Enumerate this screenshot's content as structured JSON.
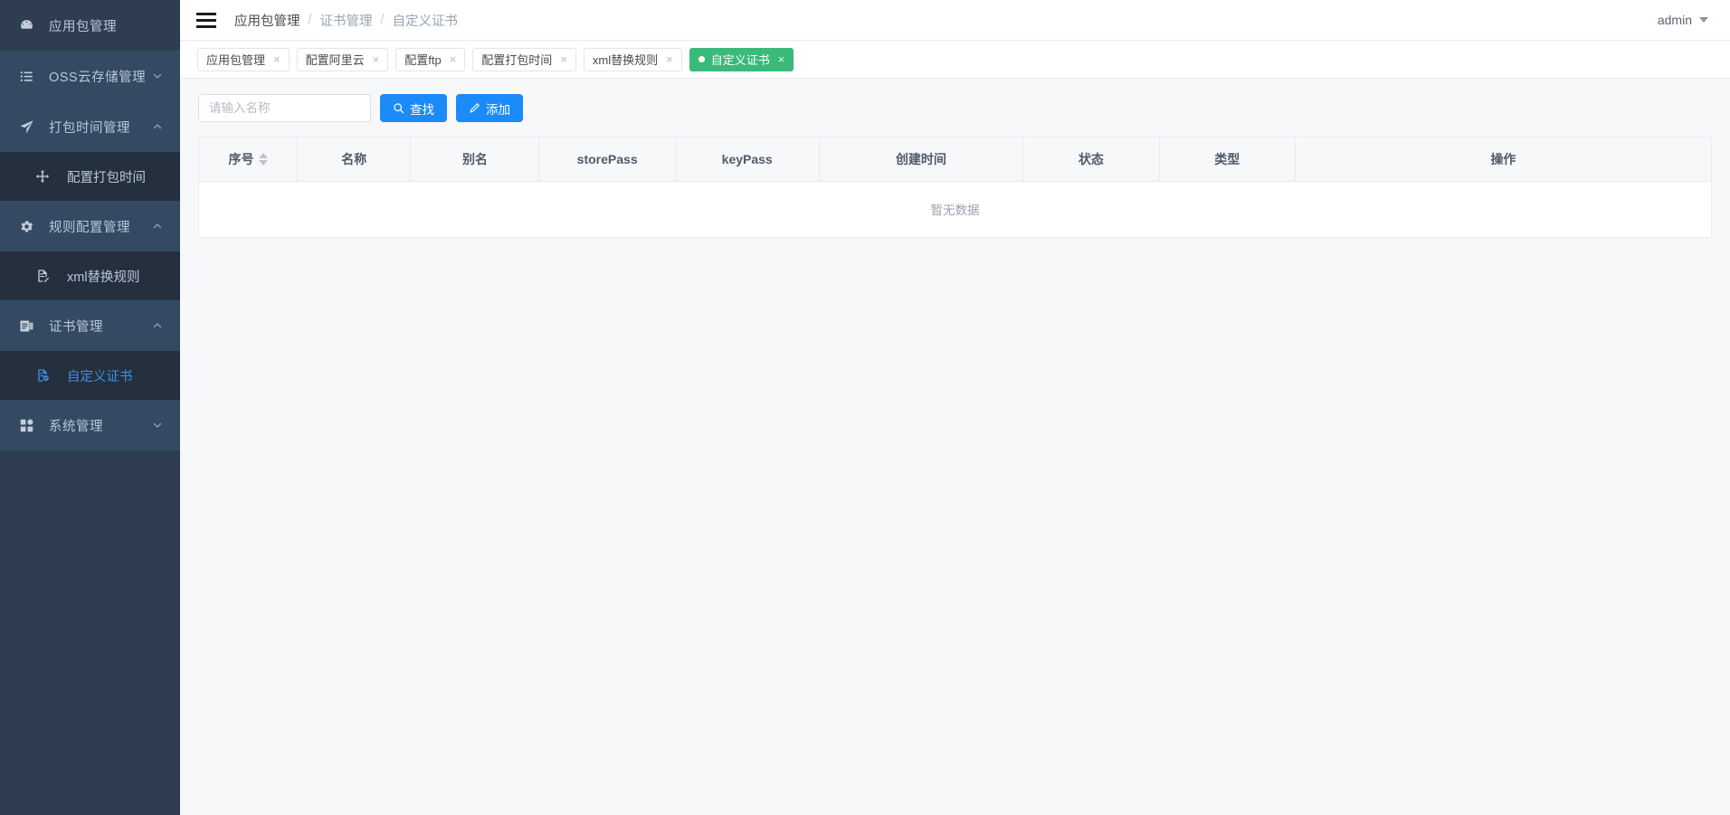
{
  "sidebar": {
    "items": [
      {
        "label": "应用包管理",
        "icon": "dashboard-icon",
        "level": 1,
        "expandable": false,
        "expanded": false,
        "active": false,
        "shade": "plain"
      },
      {
        "label": "OSS云存储管理",
        "icon": "list-icon",
        "level": 1,
        "expandable": true,
        "expanded": false,
        "active": false,
        "shade": "raised"
      },
      {
        "label": "打包时间管理",
        "icon": "paper-plane-icon",
        "level": 1,
        "expandable": true,
        "expanded": true,
        "active": false,
        "shade": "raised"
      },
      {
        "label": "配置打包时间",
        "icon": "move-arrows-icon",
        "level": 2,
        "expandable": false,
        "expanded": false,
        "active": false,
        "shade": "sub"
      },
      {
        "label": "规则配置管理",
        "icon": "gear-icon",
        "level": 1,
        "expandable": true,
        "expanded": true,
        "active": false,
        "shade": "raised"
      },
      {
        "label": "xml替换规则",
        "icon": "file-edit-icon",
        "level": 2,
        "expandable": false,
        "expanded": false,
        "active": false,
        "shade": "sub"
      },
      {
        "label": "证书管理",
        "icon": "certificate-icon",
        "level": 1,
        "expandable": true,
        "expanded": true,
        "active": false,
        "shade": "raised"
      },
      {
        "label": "自定义证书",
        "icon": "file-check-icon",
        "level": 2,
        "expandable": false,
        "expanded": false,
        "active": true,
        "shade": "sub"
      },
      {
        "label": "系统管理",
        "icon": "grid-icon",
        "level": 1,
        "expandable": true,
        "expanded": false,
        "active": false,
        "shade": "raised"
      }
    ]
  },
  "topbar": {
    "menu_toggle_icon": "hamburger-icon",
    "breadcrumb": [
      "应用包管理",
      "证书管理",
      "自定义证书"
    ],
    "breadcrumb_separator": "/",
    "user": "admin",
    "user_caret_icon": "chevron-down-icon"
  },
  "tabs": [
    {
      "label": "应用包管理",
      "active": false,
      "closable": true
    },
    {
      "label": "配置阿里云",
      "active": false,
      "closable": true
    },
    {
      "label": "配置ftp",
      "active": false,
      "closable": true
    },
    {
      "label": "配置打包时间",
      "active": false,
      "closable": true
    },
    {
      "label": "xml替换规则",
      "active": false,
      "closable": true
    },
    {
      "label": "自定义证书",
      "active": true,
      "closable": true
    }
  ],
  "tab_close_glyph": "×",
  "toolbar": {
    "search_placeholder": "请输入名称",
    "search_value": "",
    "search_button_label": "查找",
    "search_button_icon": "search-icon",
    "add_button_label": "添加",
    "add_button_icon": "pencil-icon"
  },
  "table": {
    "columns": [
      {
        "label": "序号",
        "sortable": true,
        "width": "6.5%"
      },
      {
        "label": "名称",
        "sortable": false,
        "width": "7.5%"
      },
      {
        "label": "别名",
        "sortable": false,
        "width": "8.5%"
      },
      {
        "label": "storePass",
        "sortable": false,
        "width": "9%"
      },
      {
        "label": "keyPass",
        "sortable": false,
        "width": "9.5%"
      },
      {
        "label": "创建时间",
        "sortable": false,
        "width": "13.5%"
      },
      {
        "label": "状态",
        "sortable": false,
        "width": "9%"
      },
      {
        "label": "类型",
        "sortable": false,
        "width": "9%"
      },
      {
        "label": "操作",
        "sortable": false,
        "width": "23%"
      }
    ],
    "rows": [],
    "empty_text": "暂无数据"
  },
  "colors": {
    "sidebar_bg": "#2e3e50",
    "sidebar_raised": "#344a63",
    "sidebar_sub": "#25303f",
    "sidebar_text": "#b8c7d9",
    "active_blue": "#3a8ee6",
    "primary_blue": "#1b8bf9",
    "tab_active_green": "#3aba79",
    "table_header_bg": "#f7f8fa",
    "border": "#e8ebef",
    "content_bg": "#f7f8fa"
  }
}
